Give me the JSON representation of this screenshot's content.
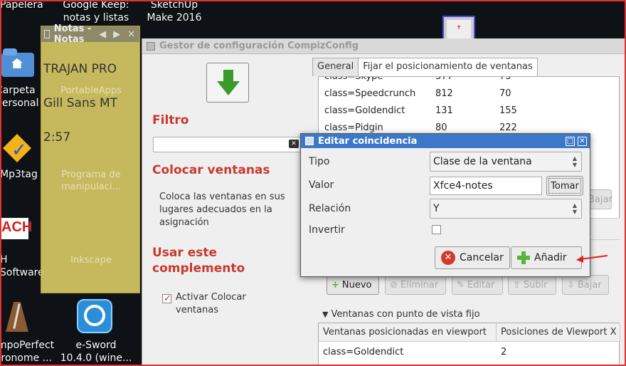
{
  "desktop": {
    "icons": [
      {
        "label": "Papelera"
      },
      {
        "label": "Google Keep:\nnotas y listas"
      },
      {
        "label": "SketchUp\nMake 2016"
      },
      {
        "label": "Carpeta\npersonal"
      },
      {
        "label": "Mp3tag"
      },
      {
        "label": "H Software"
      },
      {
        "label": "mpoPerfect\ntronome ..."
      },
      {
        "label": "e-Sword\n10.4.0 (wine..."
      }
    ]
  },
  "notes": {
    "title": "Notas - Notas",
    "lines": [
      "TRAJAN PRO",
      "Gill Sans MT",
      "2:57"
    ],
    "ghost_labels": [
      "PortableApps",
      "Programa de\nmanipulaci...",
      "Inkscape"
    ]
  },
  "compiz": {
    "title": "Gestor de configuración CompizConfig",
    "filter_heading": "Filtro",
    "plugin_heading": "Colocar ventanas",
    "plugin_desc": "Coloca las ventanas en sus lugares adecuados en la asignación",
    "use_heading": "Usar este complemento",
    "activate_label": "Activar Colocar ventanas",
    "tabs": [
      "General",
      "Fijar el posicionamiento de ventanas"
    ],
    "rows": [
      {
        "cls": "class=Skype",
        "a": "377",
        "b": "73"
      },
      {
        "cls": "class=Speedcrunch",
        "a": "812",
        "b": "70"
      },
      {
        "cls": "class=Goldendict",
        "a": "131",
        "b": "155"
      },
      {
        "cls": "class=Pidgin",
        "a": "80",
        "b": "222"
      }
    ],
    "partial_button": "Bajar",
    "buttons": [
      "Nuevo",
      "Eliminar",
      "Editar",
      "Subir",
      "Bajar"
    ],
    "fixed_heading": "Ventanas con punto de vista fijo",
    "fixed_headers": [
      "Ventanas posicionadas en viewport",
      "Posiciones de Viewport X"
    ],
    "fixed_rows": [
      {
        "cls": "class=Goldendict",
        "x": "2"
      }
    ]
  },
  "dialog": {
    "title": "Editar coincidencia",
    "tipo_label": "Tipo",
    "tipo_value": "Clase de la ventana",
    "valor_label": "Valor",
    "valor_value": "Xfce4-notes",
    "tomar_label": "Tomar",
    "relacion_label": "Relación",
    "relacion_value": "Y",
    "invertir_label": "Invertir",
    "cancel_label": "Cancelar",
    "add_label": "Añadir"
  },
  "colors": {
    "accent_red": "#c8392e",
    "dialog_title": "#3b78c7",
    "notes_bg": "#d6c864"
  }
}
